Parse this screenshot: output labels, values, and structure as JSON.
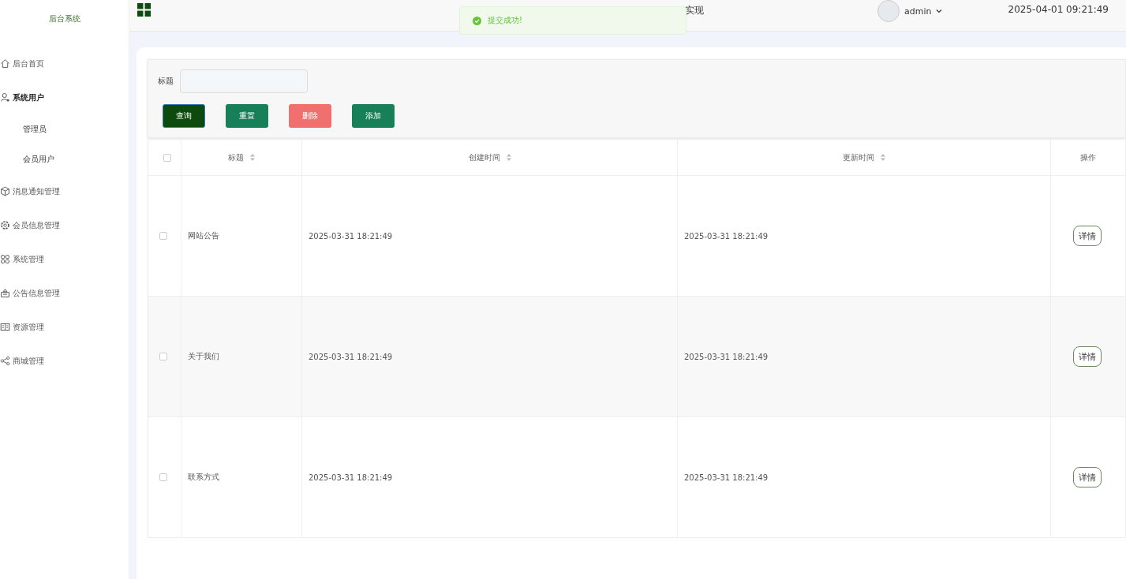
{
  "sidebar": {
    "title": "后台系统",
    "items": [
      {
        "label": "后台首页"
      },
      {
        "label": "系统用户",
        "expanded": true,
        "children": [
          {
            "label": "管理员"
          },
          {
            "label": "会员用户"
          }
        ]
      },
      {
        "label": "消息通知管理"
      },
      {
        "label": "会员信息管理"
      },
      {
        "label": "系统管理"
      },
      {
        "label": "公告信息管理"
      },
      {
        "label": "资源管理"
      },
      {
        "label": "商城管理"
      }
    ]
  },
  "header": {
    "title": "实现",
    "user": "admin",
    "datetime": "2025-04-01 09:21:49"
  },
  "toast": {
    "message": "提交成功!"
  },
  "search": {
    "label": "标题",
    "buttons": [
      {
        "label": "查询",
        "kind": "primary"
      },
      {
        "label": "重置",
        "kind": "normal"
      },
      {
        "label": "删除",
        "kind": "danger"
      },
      {
        "label": "添加",
        "kind": "normal"
      }
    ]
  },
  "table": {
    "all_checked": false,
    "columns": [
      {
        "label": "标题",
        "sortable": true
      },
      {
        "label": "创建时间",
        "sortable": true
      },
      {
        "label": "更新时间",
        "sortable": true
      },
      {
        "label": "操作",
        "sortable": false
      }
    ],
    "rows": [
      {
        "checked": false,
        "title": "网站公告",
        "created": "2025-03-31 18:21:49",
        "updated": "2025-03-31 18:21:49",
        "action": "详情"
      },
      {
        "checked": false,
        "title": "关于我们",
        "created": "2025-03-31 18:21:49",
        "updated": "2025-03-31 18:21:49",
        "action": "详情"
      },
      {
        "checked": false,
        "title": "联系方式",
        "created": "2025-03-31 18:21:49",
        "updated": "2025-03-31 18:21:49",
        "action": "详情"
      }
    ]
  }
}
